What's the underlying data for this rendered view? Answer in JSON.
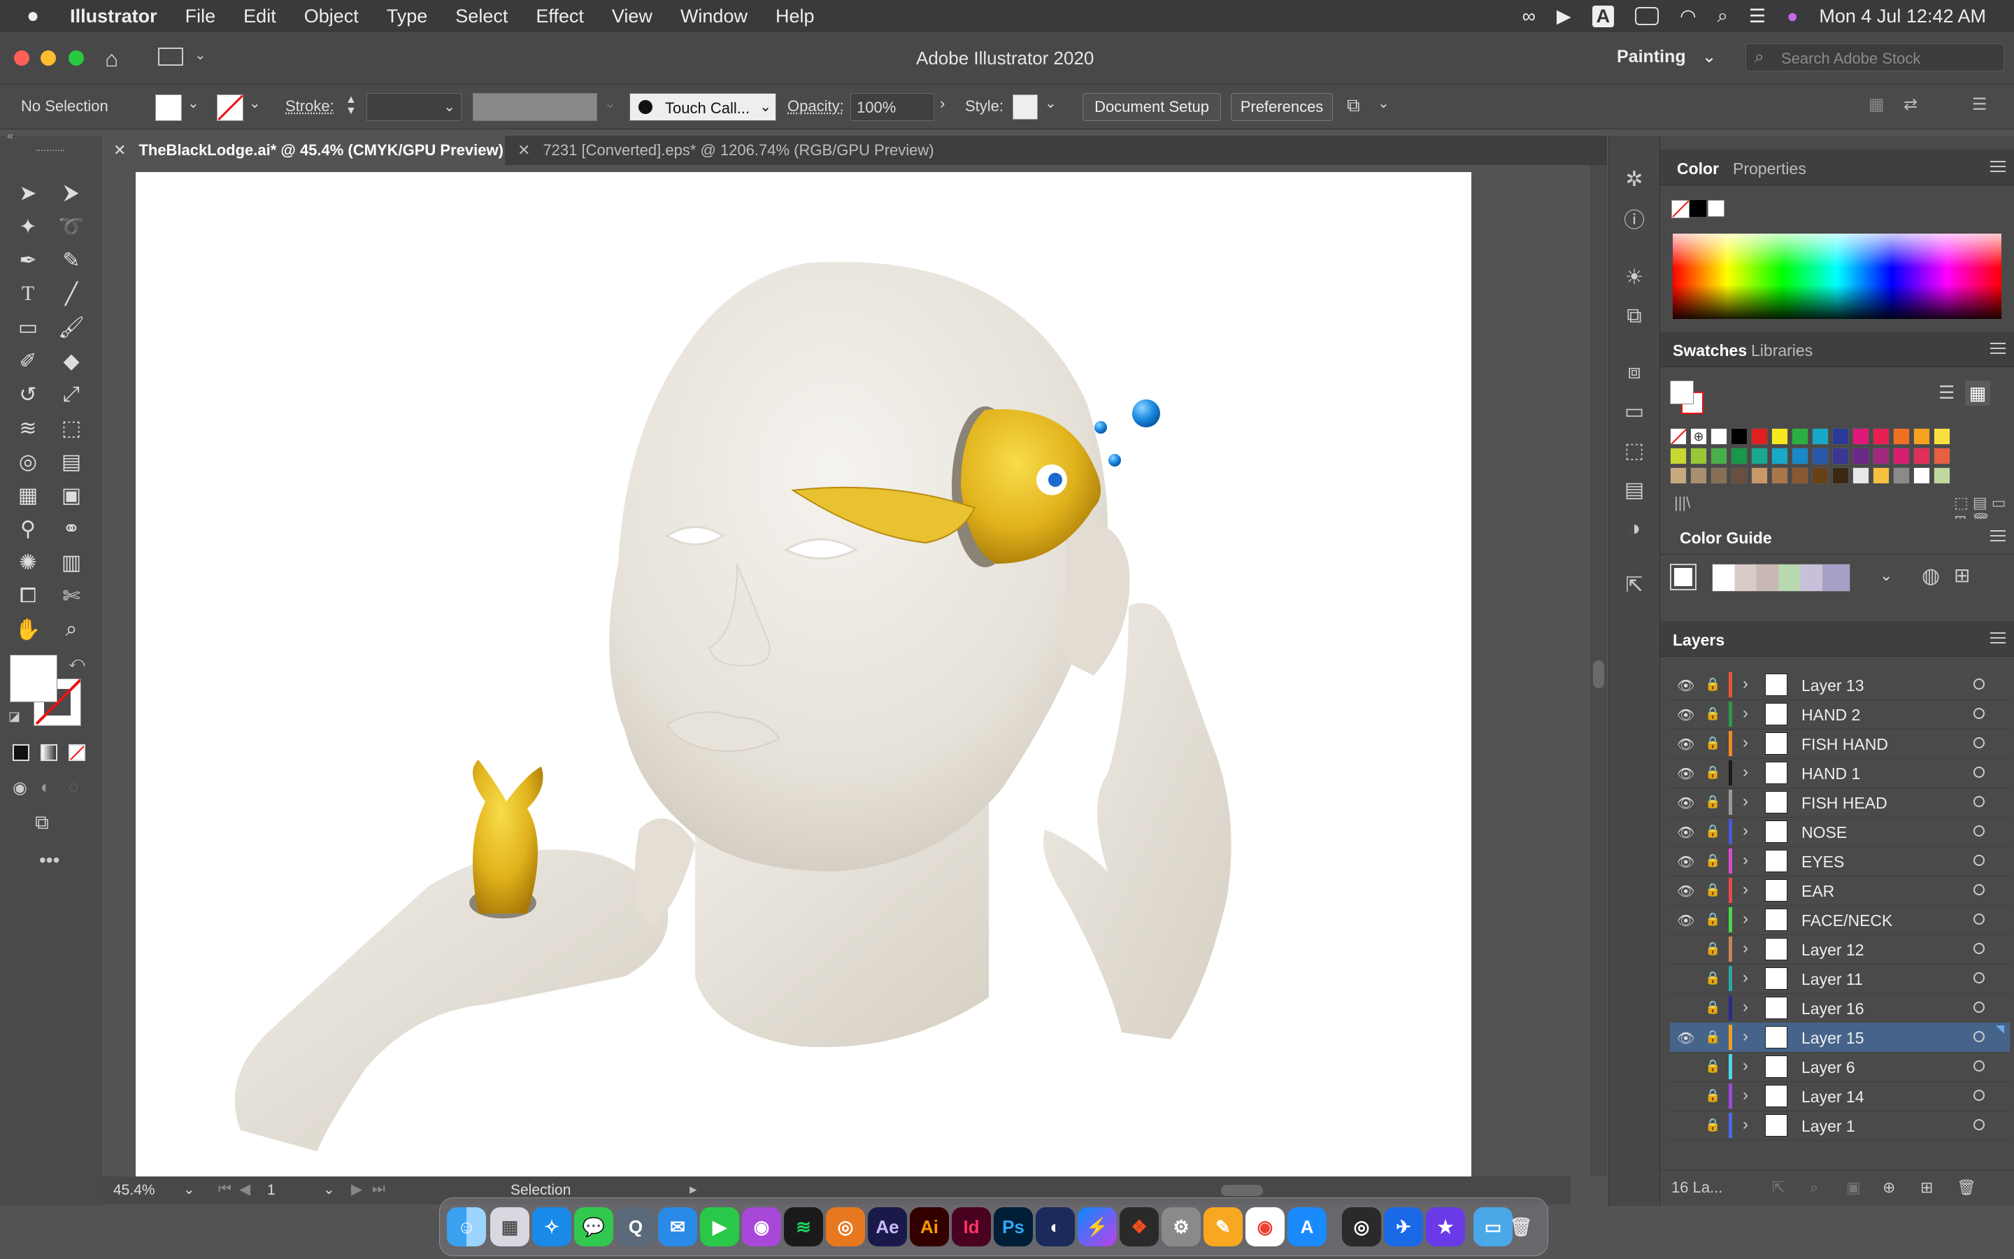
{
  "menubar": {
    "app": "Illustrator",
    "items": [
      "File",
      "Edit",
      "Object",
      "Type",
      "Select",
      "Effect",
      "View",
      "Window",
      "Help"
    ],
    "clock": "Mon 4 Jul  12:42 AM"
  },
  "titlebar": {
    "title": "Adobe Illustrator 2020",
    "workspace": "Painting",
    "search_placeholder": "Search Adobe Stock"
  },
  "control": {
    "selection": "No Selection",
    "stroke_label": "Stroke:",
    "brush": "Touch Call...",
    "opacity_label": "Opacity:",
    "opacity_value": "100%",
    "style_label": "Style:",
    "document_setup": "Document Setup",
    "preferences": "Preferences"
  },
  "tabs": [
    {
      "label": "TheBlackLodge.ai* @ 45.4% (CMYK/GPU Preview)",
      "active": true
    },
    {
      "label": "7231 [Converted].eps* @ 1206.74% (RGB/GPU Preview)",
      "active": false
    }
  ],
  "status": {
    "zoom": "45.4%",
    "artboard": "1",
    "tool": "Selection"
  },
  "panels": {
    "color_tab": "Color",
    "properties_tab": "Properties",
    "swatches_tab": "Swatches",
    "libraries_tab": "Libraries",
    "color_guide": "Color Guide",
    "layers_title": "Layers",
    "layers_count": "16 La..."
  },
  "layers": [
    {
      "name": "Layer 13",
      "visible": true,
      "color": "#e8563a"
    },
    {
      "name": "HAND 2",
      "visible": true,
      "color": "#2e9a47"
    },
    {
      "name": "FISH HAND",
      "visible": true,
      "color": "#f08a24"
    },
    {
      "name": "HAND 1",
      "visible": true,
      "color": "#1a1a1a"
    },
    {
      "name": "FISH HEAD",
      "visible": true,
      "color": "#9a9a9a"
    },
    {
      "name": "NOSE",
      "visible": true,
      "color": "#4a5ad8"
    },
    {
      "name": "EYES",
      "visible": true,
      "color": "#d84ad0"
    },
    {
      "name": "EAR",
      "visible": true,
      "color": "#e84a4a"
    },
    {
      "name": "FACE/NECK",
      "visible": true,
      "color": "#4ad84a"
    },
    {
      "name": "Layer 12",
      "visible": false,
      "color": "#c8845a"
    },
    {
      "name": "Layer 11",
      "visible": false,
      "color": "#2aa8a8"
    },
    {
      "name": "Layer 16",
      "visible": false,
      "color": "#2a2a8a"
    },
    {
      "name": "Layer 15",
      "visible": true,
      "color": "#f0a020",
      "selected": true
    },
    {
      "name": "Layer 6",
      "visible": false,
      "color": "#4ad8e8"
    },
    {
      "name": "Layer 14",
      "visible": false,
      "color": "#9a4ad8"
    },
    {
      "name": "Layer 1",
      "visible": false,
      "color": "#4a6ae8"
    }
  ],
  "dock_apps": [
    "Finder",
    "Launchpad",
    "Safari",
    "Messages",
    "QuickTime",
    "Mail",
    "FaceTime",
    "Podcasts",
    "Spotify",
    "Blender",
    "After Effects",
    "Illustrator",
    "InDesign",
    "Photoshop",
    "Cinema 4D",
    "Messenger",
    "Figma",
    "System Preferences",
    "Pages",
    "Chrome",
    "App Store",
    "Logic",
    "Spark",
    "iMovie",
    "Downloads",
    "Trash"
  ],
  "dock_labels": {
    "ae": "Ae",
    "ai": "Ai",
    "id": "Id",
    "ps": "Ps"
  }
}
